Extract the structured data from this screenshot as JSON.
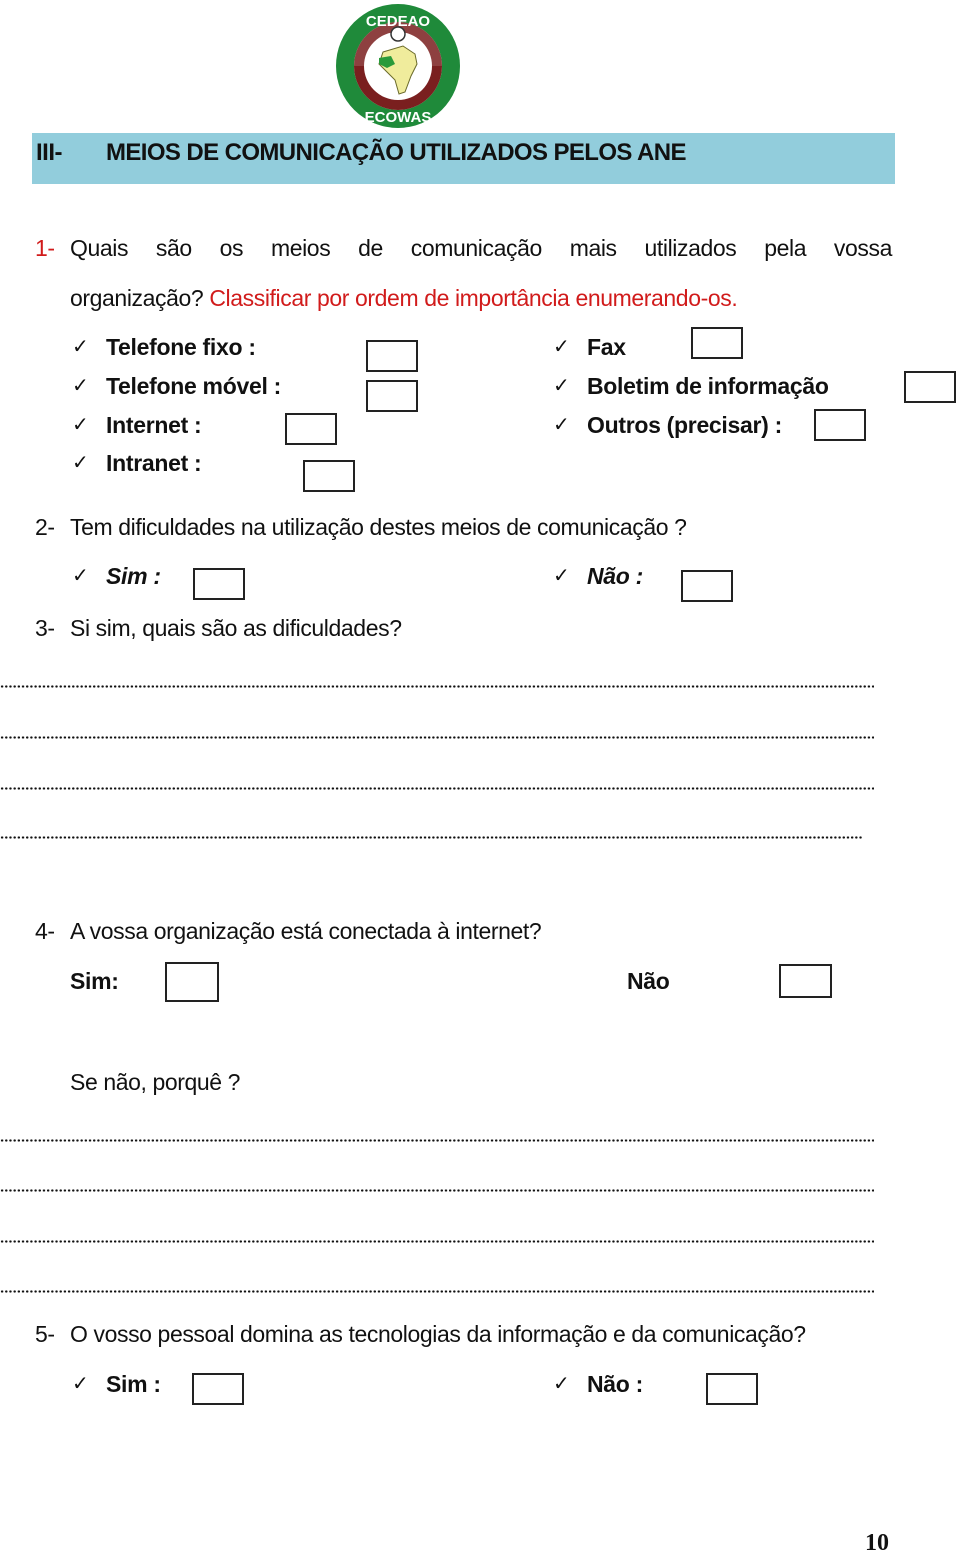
{
  "logo": {
    "top_text": "CEDEAO",
    "bottom_text": "ECOWAS",
    "icon": "ecowas-emblem-icon"
  },
  "section": {
    "number": "III-",
    "title": "MEIOS DE COMUNICAÇÃO UTILIZADOS PELOS ANE",
    "color": "#92cddc"
  },
  "q1": {
    "number": "1-",
    "text_line1": "Quais são os meios de comunicação mais utilizados pela vossa",
    "text_line2_black": "organização?",
    "text_line2_red": "Classificar por ordem de importância enumerando-os.",
    "accent_color": "#d11b1b",
    "check_glyph": "✓",
    "options_left": [
      "Telefone fixo :",
      "Telefone móvel :",
      "Internet :",
      "Intranet :"
    ],
    "options_right": [
      "Fax",
      "Boletim de informação",
      "Outros (precisar) :"
    ]
  },
  "q2": {
    "number": "2-",
    "text": "Tem dificuldades na utilização destes meios de comunicação ?",
    "yes_label": "Sim :",
    "no_label": "Não :"
  },
  "q3": {
    "number": "3-",
    "text": "Si sim, quais são as dificuldades?",
    "answer_lines": 4
  },
  "q4": {
    "number": "4-",
    "text": "A vossa organização está conectada à internet?",
    "yes_label": "Sim:",
    "no_label": "Não",
    "followup": "Se não, porquê ?",
    "answer_lines": 4
  },
  "q5": {
    "number": "5-",
    "text": "O vosso pessoal domina as tecnologias da informação e da comunicação?",
    "yes_label": "Sim :",
    "no_label": "Não :"
  },
  "page_number": "10"
}
